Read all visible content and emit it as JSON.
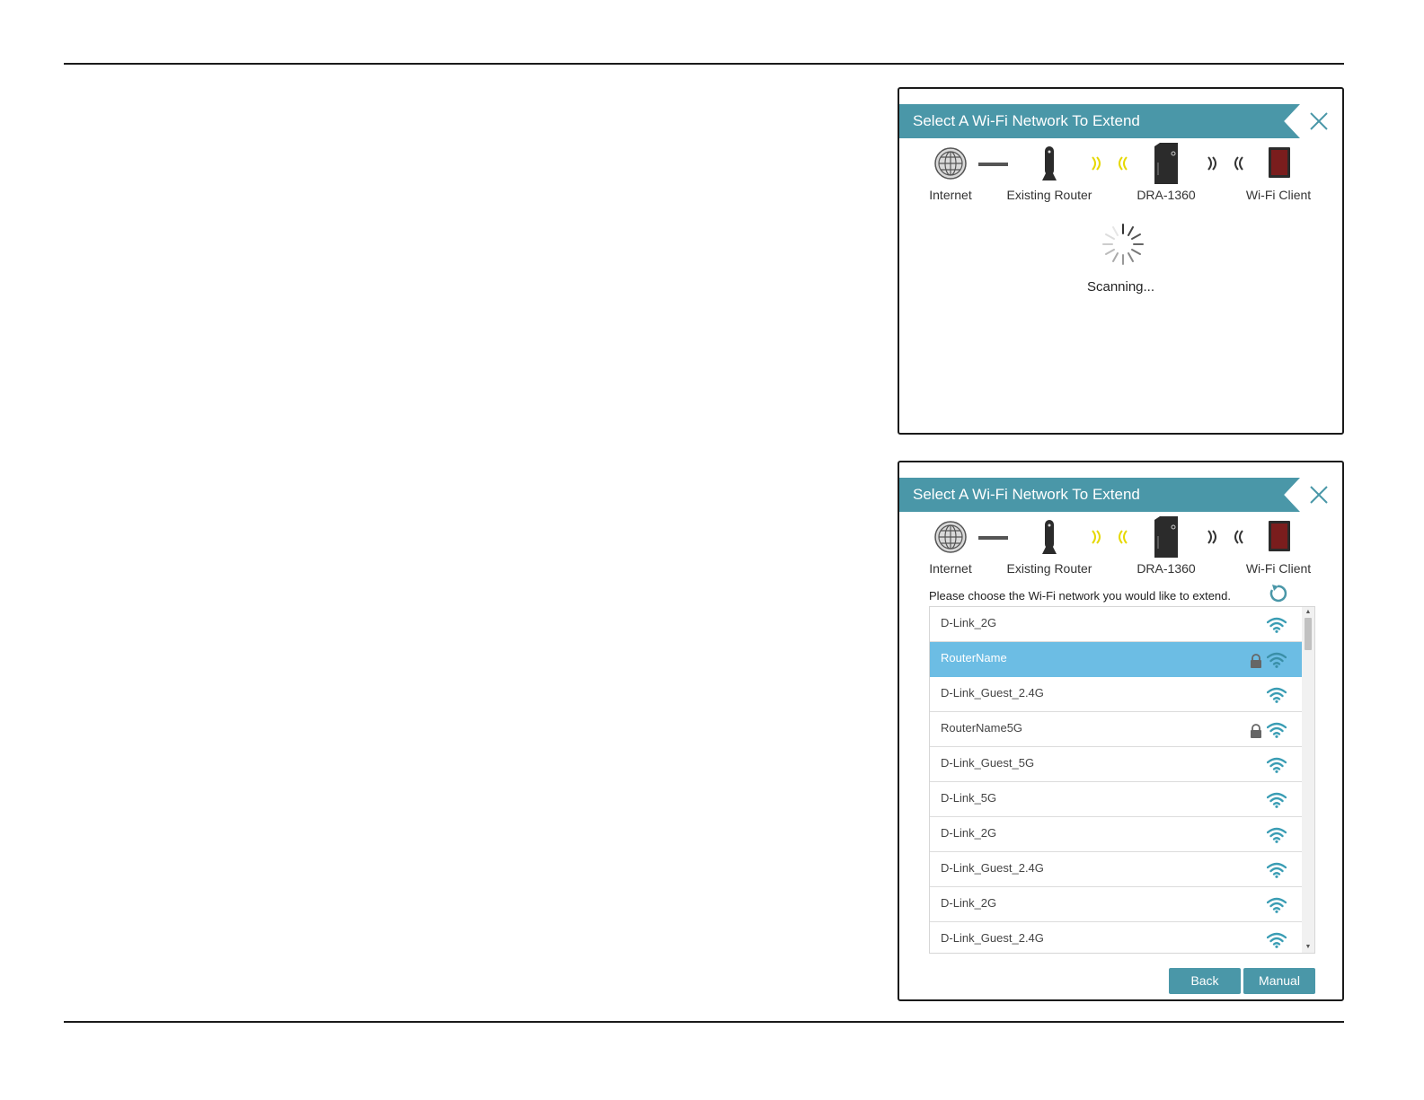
{
  "panel_scanning": {
    "title": "Select A Wi-Fi Network To Extend",
    "topology": {
      "internet": "Internet",
      "router": "Existing Router",
      "extender": "DRA-1360",
      "client": "Wi-Fi Client"
    },
    "status": "Scanning..."
  },
  "panel_list": {
    "title": "Select A Wi-Fi Network To Extend",
    "topology": {
      "internet": "Internet",
      "router": "Existing Router",
      "extender": "DRA-1360",
      "client": "Wi-Fi Client"
    },
    "instruction": "Please choose the Wi-Fi network you would like to extend.",
    "networks": [
      {
        "name": "D-Link_2G",
        "locked": false,
        "selected": false
      },
      {
        "name": "RouterName",
        "locked": true,
        "selected": true
      },
      {
        "name": "D-Link_Guest_2.4G",
        "locked": false,
        "selected": false
      },
      {
        "name": "RouterName5G",
        "locked": true,
        "selected": false
      },
      {
        "name": "D-Link_Guest_5G",
        "locked": false,
        "selected": false
      },
      {
        "name": "D-Link_5G",
        "locked": false,
        "selected": false
      },
      {
        "name": "D-Link_2G",
        "locked": false,
        "selected": false
      },
      {
        "name": "D-Link_Guest_2.4G",
        "locked": false,
        "selected": false
      },
      {
        "name": "D-Link_2G",
        "locked": false,
        "selected": false
      },
      {
        "name": "D-Link_Guest_2.4G",
        "locked": false,
        "selected": false
      }
    ],
    "buttons": {
      "back": "Back",
      "manual": "Manual"
    }
  },
  "colors": {
    "accent": "#4a97a8",
    "selected_row": "#6cbde4",
    "signal_wave_yellow": "#e6d800",
    "signal_wave_dark": "#333333"
  },
  "icons": {
    "close": "close-icon",
    "internet": "globe-icon",
    "router": "router-icon",
    "extender": "extender-icon",
    "client": "tablet-icon",
    "wave": "signal-wave-icon",
    "refresh": "refresh-icon",
    "lock": "lock-icon",
    "wifi": "wifi-icon",
    "spinner": "spinner-icon"
  }
}
